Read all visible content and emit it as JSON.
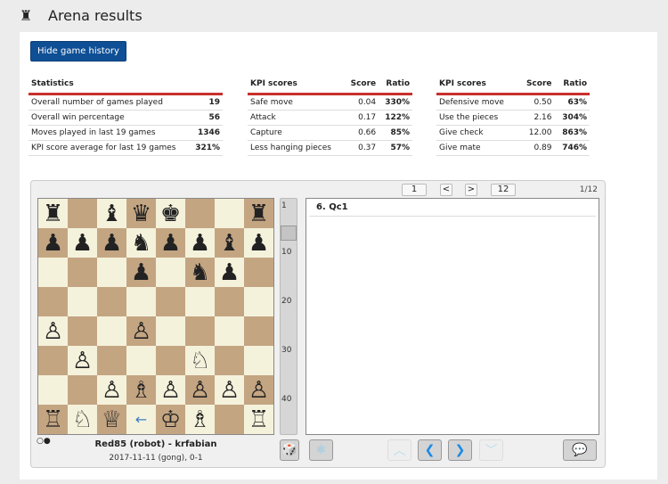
{
  "header": {
    "title": "Arena results",
    "icon": "castle-icon"
  },
  "toggle_button": "Hide game history",
  "statistics": {
    "title": "Statistics",
    "rows": [
      [
        "Overall number of games played",
        "19"
      ],
      [
        "Overall win percentage",
        "56"
      ],
      [
        "Moves played in last 19 games",
        "1346"
      ],
      [
        "KPI score average for last 19 games",
        "321%"
      ]
    ]
  },
  "kpi1": {
    "title": "KPI scores",
    "score": "Score",
    "ratio": "Ratio",
    "rows": [
      [
        "Safe move",
        "0.04",
        "330%"
      ],
      [
        "Attack",
        "0.17",
        "122%"
      ],
      [
        "Capture",
        "0.66",
        "85%"
      ],
      [
        "Less hanging pieces",
        "0.37",
        "57%"
      ]
    ]
  },
  "kpi2": {
    "title": "KPI scores",
    "score": "Score",
    "ratio": "Ratio",
    "rows": [
      [
        "Defensive move",
        "0.50",
        "63%"
      ],
      [
        "Use the pieces",
        "2.16",
        "304%"
      ],
      [
        "Give check",
        "12.00",
        "863%"
      ],
      [
        "Give mate",
        "0.89",
        "746%"
      ]
    ]
  },
  "board": {
    "fen_rows": [
      "r.bqk..r",
      "pppnppbp",
      "...p.np.",
      "........",
      "P..P....",
      ".P...N..",
      "..PBPPPP",
      "RNQ.KB.R"
    ],
    "last_move_arrow": "d1-c1"
  },
  "slider": {
    "ticks": [
      "1",
      "10",
      "20",
      "30",
      "40"
    ]
  },
  "nav": {
    "first": "1",
    "prev": "<",
    "next": ">",
    "last": "12",
    "position": "1/12"
  },
  "moves": {
    "current": "6. Qc1"
  },
  "game": {
    "players": "Red85 (robot)  - krfabian",
    "info": "2017-11-11 (gong), 0-1"
  }
}
